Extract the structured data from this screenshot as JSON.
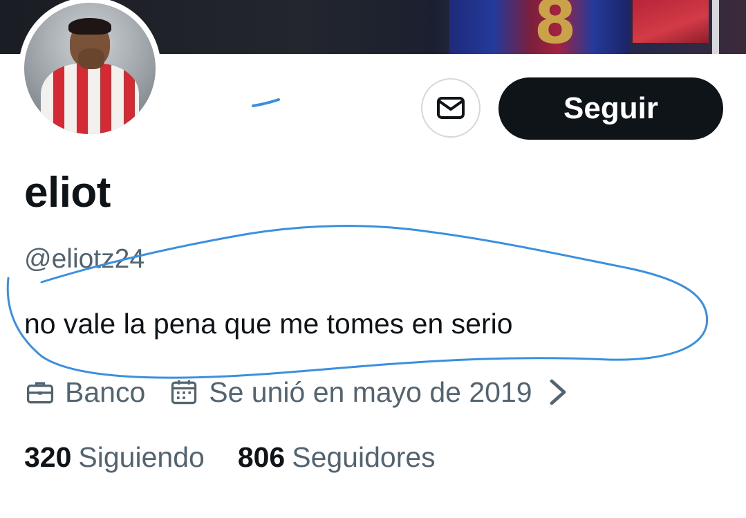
{
  "banner": {
    "jersey_number": "8"
  },
  "profile": {
    "display_name": "eliot",
    "handle": "@eliotz24",
    "bio": "no vale la pena que me tomes en serio",
    "profession": "Banco",
    "joined": "Se unió en mayo de 2019"
  },
  "actions": {
    "follow_label": "Seguir",
    "message_icon": "envelope-icon"
  },
  "stats": {
    "following_count": "320",
    "following_label": "Siguiendo",
    "followers_count": "806",
    "followers_label": "Seguidores"
  },
  "icons": {
    "profession": "briefcase-icon",
    "joined": "calendar-icon",
    "more": "chevron-right-icon"
  },
  "colors": {
    "text_primary": "#0f1419",
    "text_secondary": "#536471",
    "follow_button_bg": "#0f1419",
    "border": "#cfd9de",
    "annotation_stroke": "#3b8fe0"
  }
}
